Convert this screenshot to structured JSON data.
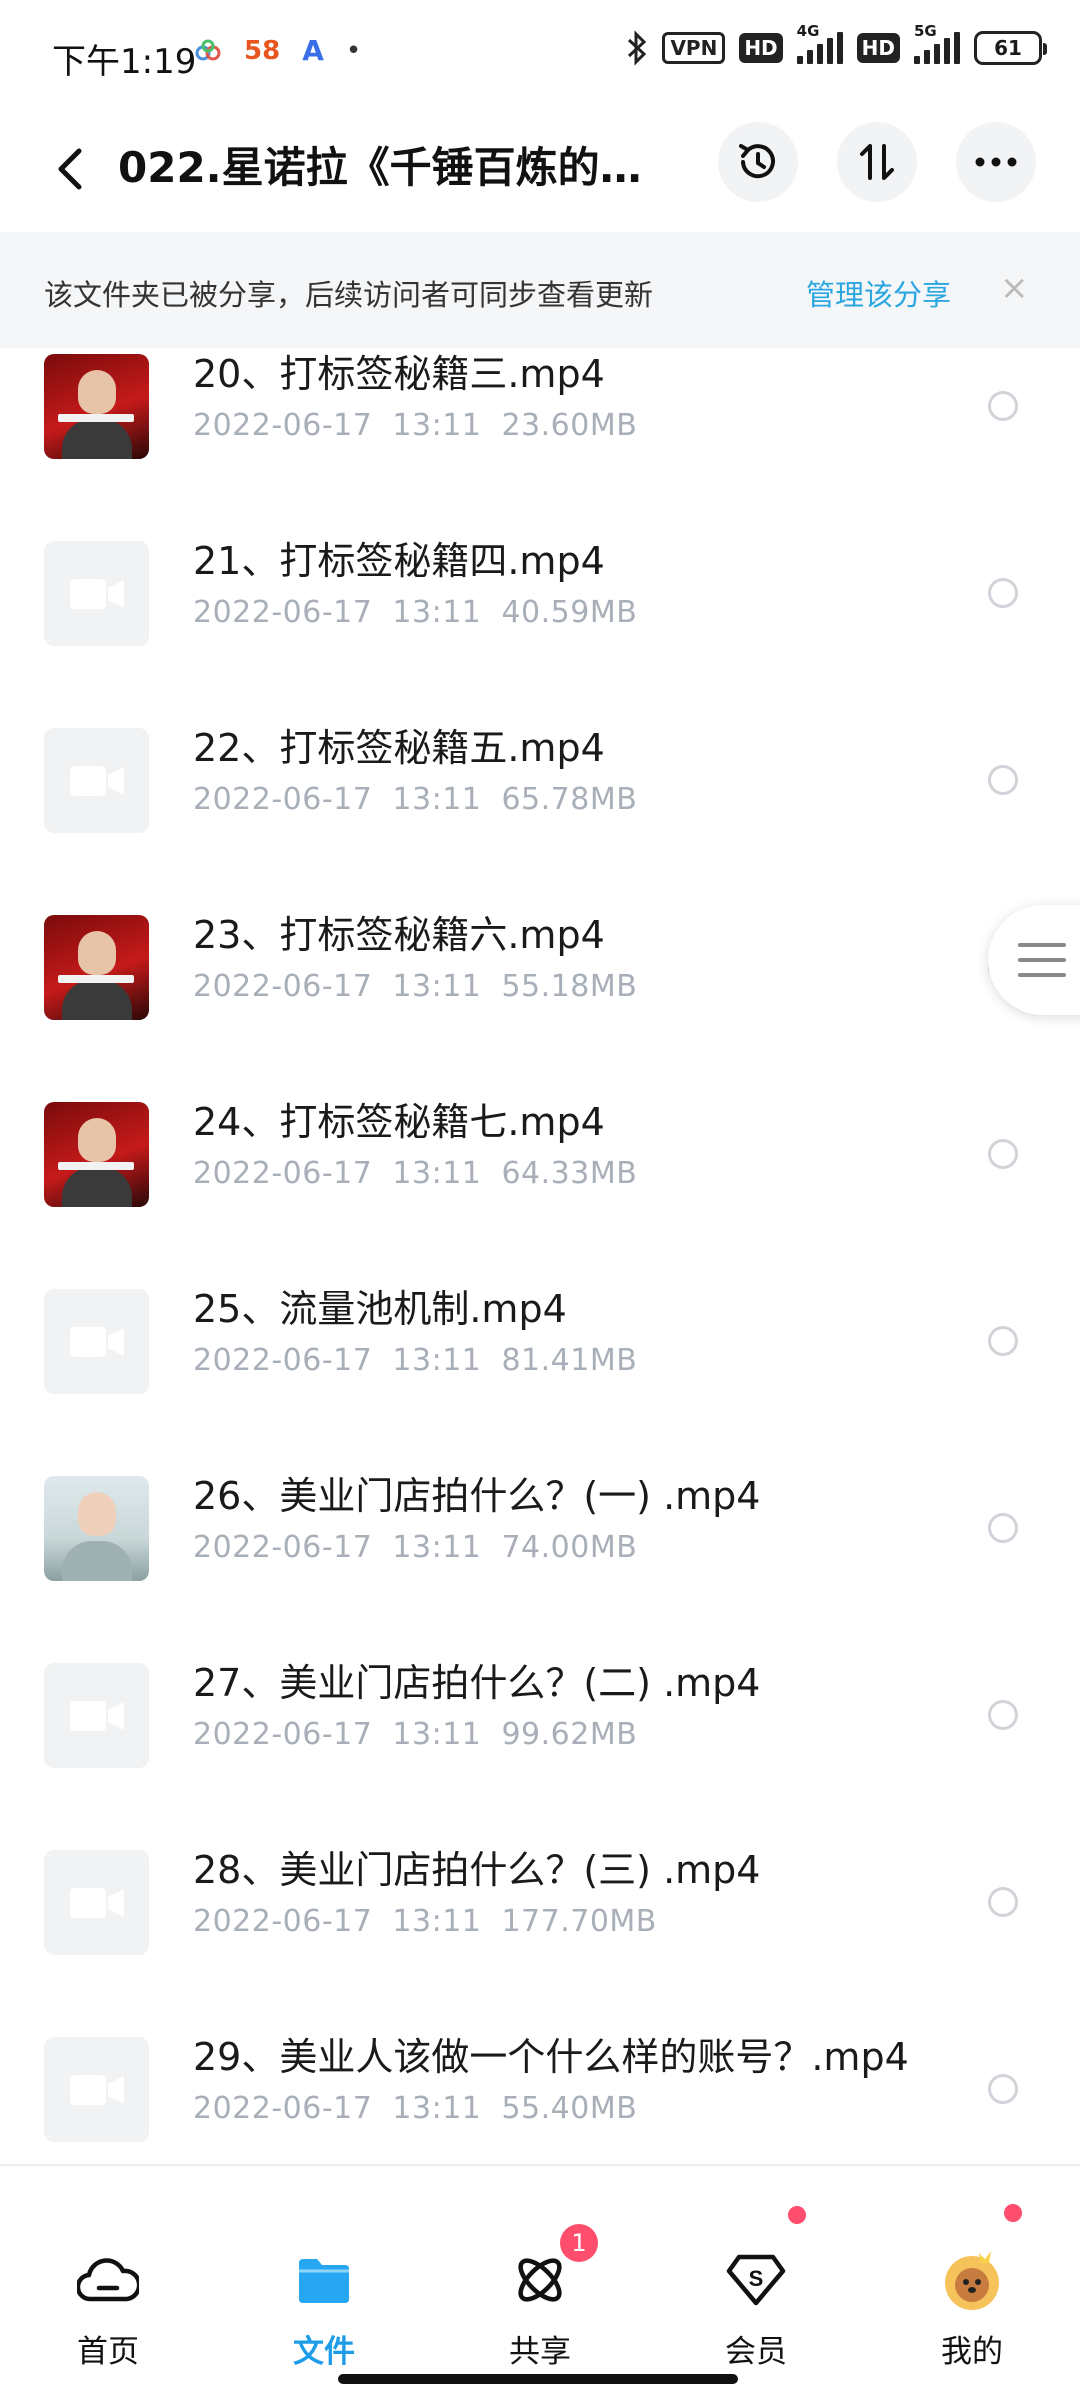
{
  "status_bar": {
    "time": "下午1:19",
    "app_icons": [
      "58",
      "A",
      "•"
    ],
    "vpn": "VPN",
    "hd": "HD",
    "net_4g": "4G",
    "net_5g": "5G",
    "battery": "61"
  },
  "header": {
    "title": "022.星诺拉《千锤百炼的…",
    "icons": [
      "back-icon",
      "history-icon",
      "sort-icon",
      "more-icon"
    ]
  },
  "banner": {
    "text": "该文件夹已被分享，后续访问者可同步查看更新",
    "link": "管理该分享",
    "close": "×"
  },
  "files": [
    {
      "name": "20、打标签秘籍三.mp4",
      "meta": "2022-06-17  13:11  23.60MB",
      "thumb": "red"
    },
    {
      "name": "21、打标签秘籍四.mp4",
      "meta": "2022-06-17  13:11  40.59MB",
      "thumb": "video"
    },
    {
      "name": "22、打标签秘籍五.mp4",
      "meta": "2022-06-17  13:11  65.78MB",
      "thumb": "video"
    },
    {
      "name": "23、打标签秘籍六.mp4",
      "meta": "2022-06-17  13:11  55.18MB",
      "thumb": "red"
    },
    {
      "name": "24、打标签秘籍七.mp4",
      "meta": "2022-06-17  13:11  64.33MB",
      "thumb": "red"
    },
    {
      "name": "25、流量池机制.mp4",
      "meta": "2022-06-17  13:11  81.41MB",
      "thumb": "video"
    },
    {
      "name": "26、美业门店拍什么？(一) .mp4",
      "meta": "2022-06-17  13:11  74.00MB",
      "thumb": "photo"
    },
    {
      "name": "27、美业门店拍什么？(二) .mp4",
      "meta": "2022-06-17  13:11  99.62MB",
      "thumb": "video"
    },
    {
      "name": "28、美业门店拍什么？(三) .mp4",
      "meta": "2022-06-17  13:11  177.70MB",
      "thumb": "video"
    },
    {
      "name": "29、美业人该做一个什么样的账号？.mp4",
      "meta": "2022-06-17  13:11  55.40MB",
      "thumb": "video"
    }
  ],
  "nav": {
    "items": [
      {
        "label": "首页",
        "icon": "cloud-icon"
      },
      {
        "label": "文件",
        "icon": "folder-icon"
      },
      {
        "label": "共享",
        "icon": "share-atom-icon"
      },
      {
        "label": "会员",
        "icon": "vip-shield-icon"
      },
      {
        "label": "我的",
        "icon": "avatar-icon"
      }
    ],
    "share_badge": "1",
    "active_color": "#1f9ce8",
    "badge_color": "#ff4d6d"
  }
}
